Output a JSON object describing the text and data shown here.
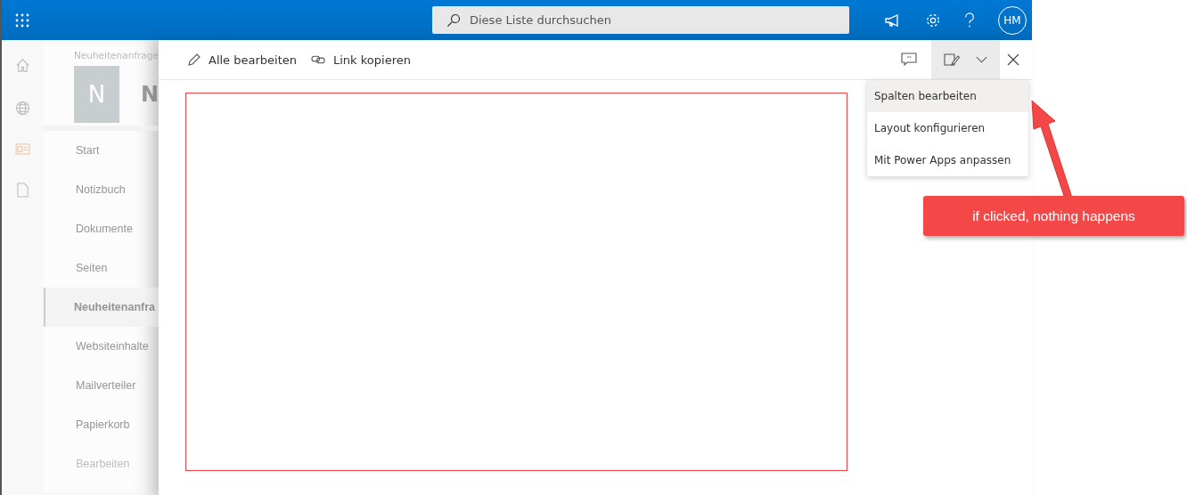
{
  "topbar": {
    "search": {
      "placeholder": "Diese Liste durchsuchen"
    },
    "avatar": "HM"
  },
  "site": {
    "breadcrumb": "Neuheitenanfrage",
    "logo_letter": "N",
    "title": "N"
  },
  "nav": [
    {
      "label": "Start",
      "selected": false,
      "disabled": false
    },
    {
      "label": "Notizbuch",
      "selected": false,
      "disabled": false
    },
    {
      "label": "Dokumente",
      "selected": false,
      "disabled": false
    },
    {
      "label": "Seiten",
      "selected": false,
      "disabled": false
    },
    {
      "label": "Neuheitenanfra",
      "selected": true,
      "disabled": false
    },
    {
      "label": "Websiteinhalte",
      "selected": false,
      "disabled": false
    },
    {
      "label": "Mailverteiler",
      "selected": false,
      "disabled": false
    },
    {
      "label": "Papierkorb",
      "selected": false,
      "disabled": false
    },
    {
      "label": "Bearbeiten",
      "selected": false,
      "disabled": true
    }
  ],
  "panel": {
    "commands": [
      {
        "kind": "edit",
        "label": "Alle bearbeiten"
      },
      {
        "kind": "link",
        "label": "Link kopieren"
      }
    ],
    "form_menu": {
      "expanded": true,
      "items": [
        {
          "label": "Spalten bearbeiten",
          "selected": true
        },
        {
          "label": "Layout konfigurieren",
          "selected": false
        },
        {
          "label": "Mit Power Apps anpassen",
          "selected": false
        }
      ]
    }
  },
  "annotation": {
    "text": "if clicked, nothing happens"
  }
}
